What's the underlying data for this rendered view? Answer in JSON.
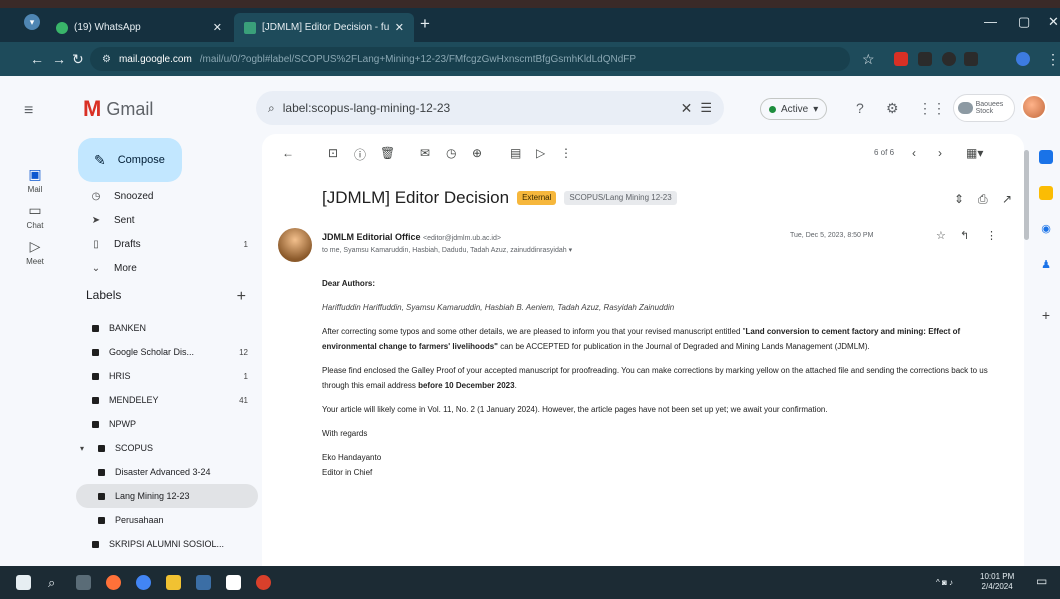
{
  "browser": {
    "tabs": [
      {
        "label": "(19) WhatsApp",
        "active": false
      },
      {
        "label": "[JDMLM] Editor Decision - fu",
        "active": true
      }
    ],
    "url_host": "mail.google.com",
    "url_path": "/mail/u/0/?ogbl#label/SCOPUS%2FLang+Mining+12-23/FMfcgzGwHxnscmtBfgGsmhKldLdQNdFP"
  },
  "gmail": {
    "app_name": "Gmail",
    "search_query": "label:scopus-lang-mining-12-23",
    "status_label": "Active",
    "account_label": "Baouees Stock"
  },
  "rail": [
    {
      "icon": "mail-icon",
      "label": "Mail"
    },
    {
      "icon": "chat-icon",
      "label": "Chat"
    },
    {
      "icon": "meet-icon",
      "label": "Meet"
    }
  ],
  "nav": {
    "compose_label": "Compose",
    "items": [
      {
        "icon": "snoozed-icon",
        "label": "Snoozed",
        "count": ""
      },
      {
        "icon": "sent-icon",
        "label": "Sent",
        "count": ""
      },
      {
        "icon": "drafts-icon",
        "label": "Drafts",
        "count": "1"
      },
      {
        "icon": "more-icon",
        "label": "More",
        "count": ""
      }
    ],
    "labels_heading": "Labels",
    "labels": [
      {
        "label": "BANKEN",
        "count": "",
        "child": false
      },
      {
        "label": "Google Scholar Dis...",
        "count": "12",
        "child": false
      },
      {
        "label": "HRIS",
        "count": "1",
        "child": false
      },
      {
        "label": "MENDELEY",
        "count": "41",
        "child": false
      },
      {
        "label": "NPWP",
        "count": "",
        "child": false
      },
      {
        "label": "SCOPUS",
        "count": "",
        "child": false
      },
      {
        "label": "Disaster Advanced 3-24",
        "count": "",
        "child": true
      },
      {
        "label": "Lang Mining 12-23",
        "count": "",
        "child": true
      },
      {
        "label": "Perusahaan",
        "count": "",
        "child": true
      },
      {
        "label": "SKRIPSI ALUMNI SOSIOL...",
        "count": "",
        "child": false
      }
    ]
  },
  "message": {
    "pager": "6 of 6",
    "subject": "[JDMLM] Editor Decision",
    "chips": [
      "External",
      "SCOPUS/Lang Mining 12-23"
    ],
    "sender_name": "JDMLM Editorial Office",
    "sender_email": "<editor@jdmlm.ub.ac.id>",
    "recipients": "to me, Syamsu Kamaruddin, Hasbiah, Dadudu, Tadah Azuz, zainuddinrasyidah",
    "date": "Tue, Dec 5, 2023, 8:50 PM",
    "greeting": "Dear Authors:",
    "authors": "Hariffuddin Hariffuddin, Syamsu Kamaruddin, Hasbiah B. Aeniem, Tadah Azuz, Rasyidah Zainuddin",
    "p1_before": "After correcting some typos and some other details, we are pleased to inform you that your revised manuscript entitled \"",
    "p1_title": "Land conversion to cement factory and mining: Effect of environmental change to farmers' livelihoods\"",
    "p1_after": " can be ACCEPTED for publication in the Journal of Degraded and Mining Lands Management (JDMLM).",
    "p2_before": "Please find enclosed the Galley Proof of your accepted manuscript for proofreading. You can make corrections by marking yellow on the attached file and sending the corrections back to us through this email address ",
    "p2_bold": "before 10 December 2023",
    "p2_after": ".",
    "p3": "Your article will likely come in Vol. 11, No. 2 (1 January 2024). However, the article pages have not been set up yet; we await your confirmation.",
    "closing": "With regards",
    "sig_name": "Eko Handayanto",
    "sig_title": "Editor in Chief"
  },
  "taskbar": {
    "time": "10:01 PM",
    "date": "2/4/2024"
  },
  "colors": {
    "chrome_frame": "#15303f",
    "chrome_toolbar": "#1e4b5b",
    "compose_bg": "#c2e7ff",
    "external_chip": "#f6b73c",
    "gmail_red": "#d93025"
  }
}
